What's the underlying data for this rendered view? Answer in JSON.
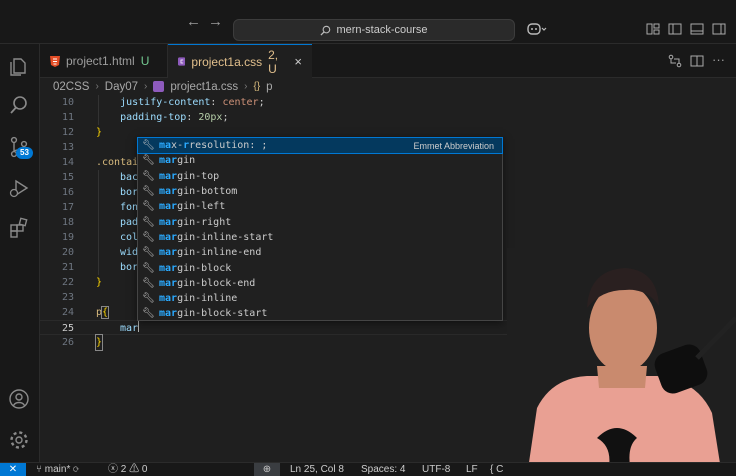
{
  "titlebar": {
    "search_text": "mern-stack-course",
    "back_icon": "arrow-left-icon",
    "forward_icon": "arrow-right-icon"
  },
  "tabs": [
    {
      "label": "project1.html",
      "status": "U",
      "icon": "html5-icon"
    },
    {
      "label": "project1a.css",
      "status": "2, U",
      "icon": "css-file-icon",
      "close": "×"
    }
  ],
  "breadcrumb": {
    "folder1": "02CSS",
    "folder2": "Day07",
    "file": "project1a.css",
    "symbol": "p"
  },
  "activity_badge": "53",
  "editor": {
    "lines": [
      {
        "n": "10"
      },
      {
        "n": "11"
      },
      {
        "n": "12"
      },
      {
        "n": "13"
      },
      {
        "n": "14"
      },
      {
        "n": "15"
      },
      {
        "n": "16"
      },
      {
        "n": "17"
      },
      {
        "n": "18"
      },
      {
        "n": "19"
      },
      {
        "n": "20"
      },
      {
        "n": "21"
      },
      {
        "n": "22"
      },
      {
        "n": "23"
      },
      {
        "n": "24"
      },
      {
        "n": "25"
      },
      {
        "n": "26"
      }
    ],
    "code": {
      "l10_prop": "justify-content",
      "l10_val": "center",
      "l11_prop": "padding-top",
      "l11_val": "20px",
      "l12": "}",
      "l14": ".contai",
      "l15": "bac",
      "l16": "bor",
      "l17": "fon",
      "l18": "pad",
      "l19": "col",
      "l20": "wid",
      "l21": "bor",
      "l22": "}",
      "l24_sel": "p",
      "l24_brace": "{",
      "l25": "mar",
      "l26": "}"
    }
  },
  "suggestions": {
    "detail": "Emmet Abbreviation",
    "items": [
      {
        "hl": "ma",
        "rest_hl": "x-",
        "rest": "resolution: ;",
        "mid": "r"
      },
      {
        "hl": "mar",
        "rest": "gin"
      },
      {
        "hl": "mar",
        "rest": "gin-top"
      },
      {
        "hl": "mar",
        "rest": "gin-bottom"
      },
      {
        "hl": "mar",
        "rest": "gin-left"
      },
      {
        "hl": "mar",
        "rest": "gin-right"
      },
      {
        "hl": "mar",
        "rest": "gin-inline-start"
      },
      {
        "hl": "mar",
        "rest": "gin-inline-end"
      },
      {
        "hl": "mar",
        "rest": "gin-block"
      },
      {
        "hl": "mar",
        "rest": "gin-block-end"
      },
      {
        "hl": "mar",
        "rest": "gin-inline"
      },
      {
        "hl": "mar",
        "rest": "gin-block-start"
      }
    ]
  },
  "statusbar": {
    "remote_icon": "remote-icon",
    "branch": "main*",
    "errors": "2",
    "warnings": "0",
    "position": "Ln 25, Col 8",
    "spaces": "Spaces: 4",
    "encoding": "UTF-8",
    "eol": "LF",
    "language_partial": "{ C"
  },
  "colors": {
    "accent": "#0078d4",
    "modified": "#e2c08d",
    "untracked": "#73c991",
    "match_highlight": "#2aaaff"
  }
}
